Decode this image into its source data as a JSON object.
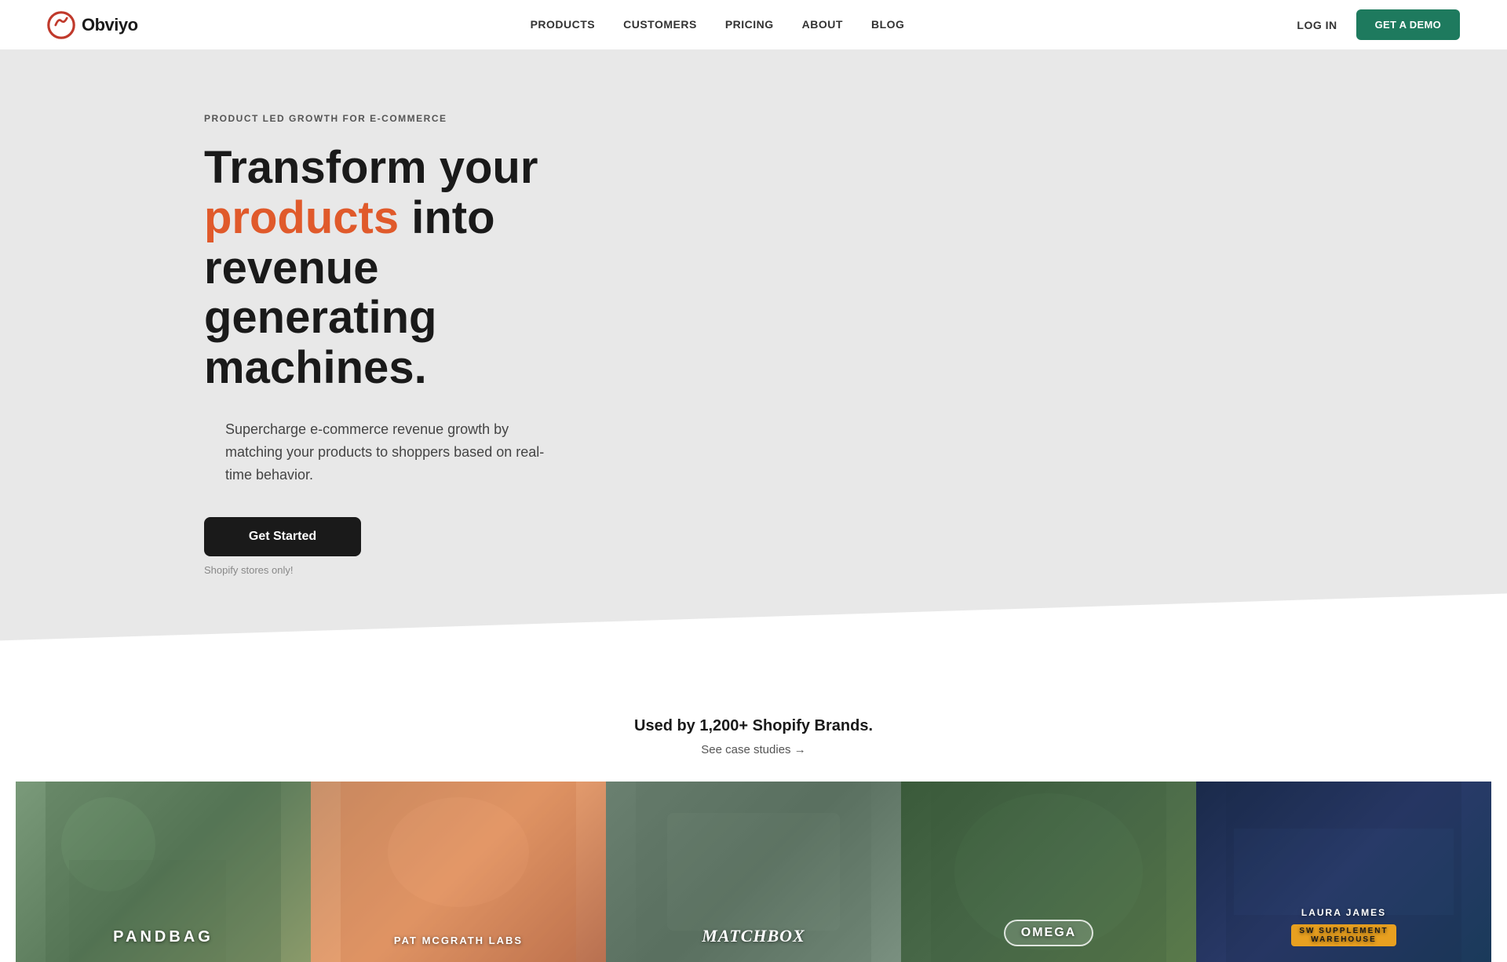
{
  "navbar": {
    "logo_text": "Obviyo",
    "nav_items": [
      {
        "label": "PRODUCTS",
        "href": "#"
      },
      {
        "label": "CUSTOMERS",
        "href": "#"
      },
      {
        "label": "PRICING",
        "href": "#"
      },
      {
        "label": "ABOUT",
        "href": "#"
      },
      {
        "label": "BLOG",
        "href": "#"
      }
    ],
    "login_label": "LOG IN",
    "demo_label": "GET A DEMO"
  },
  "hero": {
    "eyebrow": "PRODUCT LED GROWTH FOR E-COMMERCE",
    "heading_part1": "Transform your",
    "heading_highlight": "products",
    "heading_part2": " into revenue generating machines.",
    "subtext": "Supercharge e-commerce revenue growth by matching your products to shoppers based on real-time behavior.",
    "cta_label": "Get Started",
    "shopify_note": "Shopify stores only!"
  },
  "brands": {
    "heading": "Used by 1,200+ Shopify Brands.",
    "case_studies_label": "See case studies →",
    "cards": [
      {
        "label": "PANDBAG"
      },
      {
        "label": "PAT McGRATH LABS"
      },
      {
        "label": "matchbox"
      },
      {
        "label": "Omega"
      },
      {
        "label": "LAURA JAMES"
      }
    ]
  },
  "colors": {
    "accent_orange": "#e05a2b",
    "accent_green": "#1e7a5e",
    "dark": "#1a1a1a"
  }
}
